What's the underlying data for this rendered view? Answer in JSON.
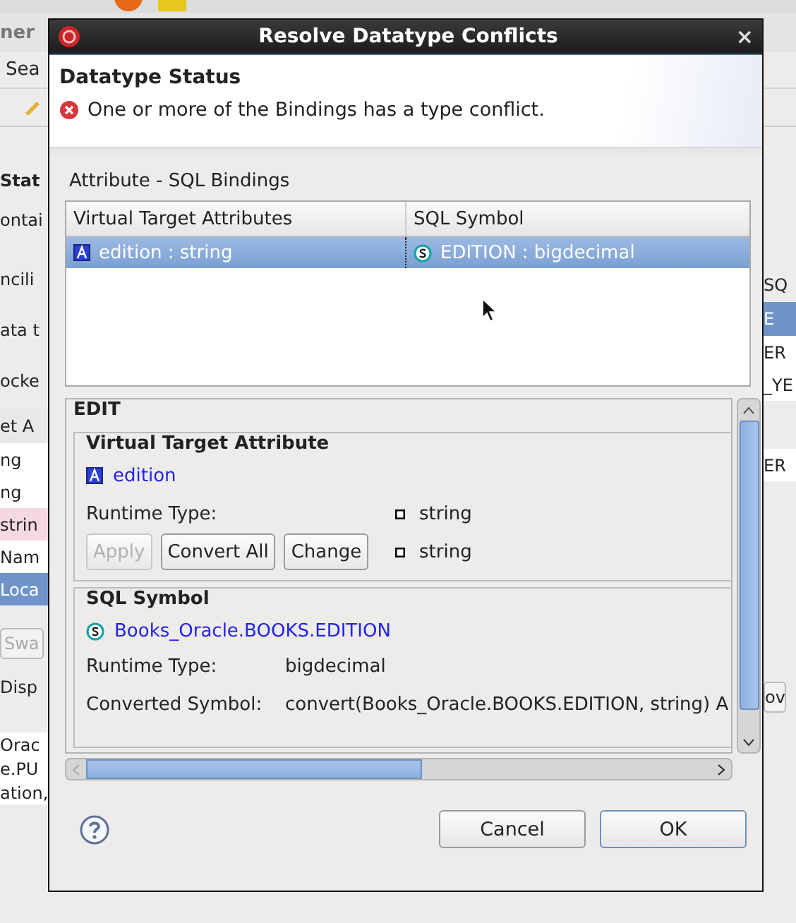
{
  "background": {
    "app_title": "ner",
    "menu": "Sea",
    "left": [
      {
        "kind": "heading",
        "text": "Stat"
      },
      {
        "kind": "text",
        "text": "ontai"
      },
      {
        "kind": "label",
        "text": "ncili"
      },
      {
        "kind": "label",
        "text": "ata t"
      },
      {
        "kind": "label",
        "text": "ocke"
      },
      {
        "kind": "header",
        "text": "et A"
      },
      {
        "kind": "row",
        "text": "ng"
      },
      {
        "kind": "row",
        "text": "ng"
      },
      {
        "kind": "row_pink",
        "text": "strin"
      },
      {
        "kind": "row",
        "text": "Nam"
      },
      {
        "kind": "row_selected",
        "text": "Loca"
      },
      {
        "kind": "button",
        "text": "Swa"
      },
      {
        "kind": "label",
        "text": "Disp"
      },
      {
        "kind": "code",
        "text": "Orac"
      },
      {
        "kind": "code",
        "text": "e.PU"
      },
      {
        "kind": "code",
        "text": "ation,"
      }
    ],
    "right": [
      {
        "kind": "header",
        "text": "SQ"
      },
      {
        "kind": "row_selected",
        "text": "E"
      },
      {
        "kind": "row",
        "text": "ER"
      },
      {
        "kind": "row",
        "text": "_YE"
      },
      {
        "kind": "row",
        "text": "ER"
      },
      {
        "kind": "button",
        "text": "ov"
      }
    ]
  },
  "dialog": {
    "title": "Resolve Datatype Conflicts",
    "close": "×",
    "header": {
      "title": "Datatype Status",
      "message": "One or more of the Bindings has a type conflict."
    },
    "bindings_label": "Attribute - SQL Bindings",
    "table": {
      "columns": [
        "Virtual Target Attributes",
        "SQL Symbol"
      ],
      "rows": [
        {
          "attribute": "edition : string",
          "symbol": "EDITION : bigdecimal",
          "selected": true
        }
      ]
    },
    "edit": {
      "title": "EDIT",
      "target": {
        "title": "Virtual Target Attribute",
        "name": "edition",
        "runtime_label": "Runtime Type:",
        "runtime_value": "string",
        "converted_value": "string",
        "buttons": [
          {
            "label": "Apply",
            "disabled": true
          },
          {
            "label": "Convert All",
            "disabled": false
          },
          {
            "label": "Change",
            "disabled": false
          }
        ]
      },
      "sql": {
        "title": "SQL Symbol",
        "name": "Books_Oracle.BOOKS.EDITION",
        "rows": [
          {
            "label": "Runtime Type:",
            "value": "bigdecimal"
          },
          {
            "label": "Converted Symbol:",
            "value": "convert(Books_Oracle.BOOKS.EDITION, string) A"
          }
        ]
      }
    },
    "buttons": [
      {
        "label": "Cancel",
        "default": false
      },
      {
        "label": "OK",
        "default": true
      }
    ]
  }
}
